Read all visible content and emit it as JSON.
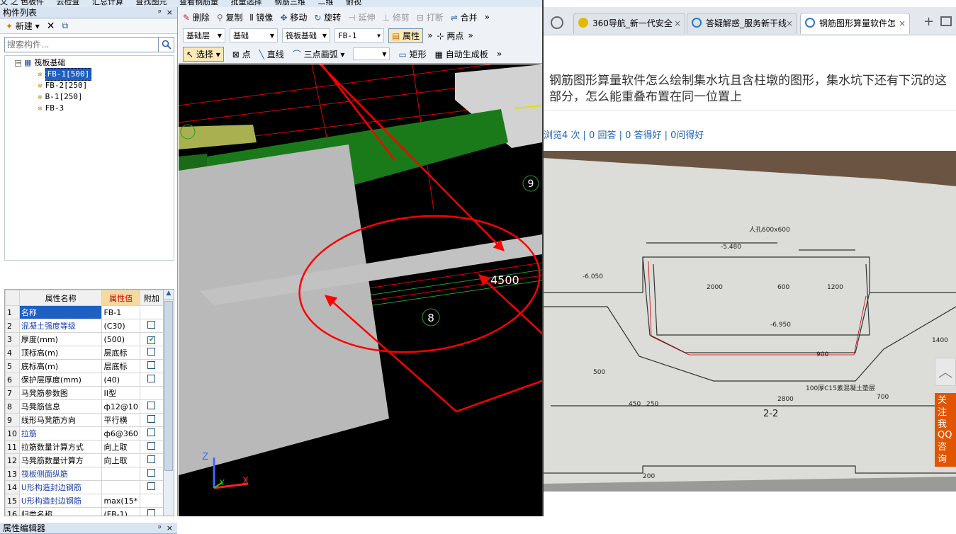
{
  "top_strip": {
    "items": [
      "文 之 色板件",
      "云检查",
      "汇总计算",
      "查找图元",
      "查看钢筋量",
      "批量选择",
      "钢筋三维",
      "二维",
      "俯视"
    ]
  },
  "left_panel": {
    "title": "构件列表",
    "controls": [
      "ᵖ",
      "×"
    ],
    "toolbar": {
      "new_label": "新建 ▾",
      "delete_icon": "✕",
      "copy_icon": "⧉"
    },
    "search": {
      "placeholder": "搜索构件..."
    },
    "tree": {
      "root": "筏板基础",
      "children": [
        "FB-1[500]",
        "FB-2[250]",
        "B-1[250]",
        "FB-3"
      ]
    }
  },
  "prop_editor": {
    "title": "属性编辑器",
    "controls": [
      "ᵖ",
      "×"
    ],
    "headers": [
      "属性名称",
      "属性值",
      "附加"
    ],
    "rows": [
      {
        "no": "1",
        "name": "名称",
        "value": "FB-1",
        "check": "none",
        "blue": true
      },
      {
        "no": "2",
        "name": "混凝土强度等级",
        "value": "(C30)",
        "check": "unchecked",
        "blue": true
      },
      {
        "no": "3",
        "name": "厚度(mm)",
        "value": "(500)",
        "check": "checked",
        "blue": false
      },
      {
        "no": "4",
        "name": "顶标高(m)",
        "value": "层底标",
        "check": "unchecked",
        "blue": false
      },
      {
        "no": "5",
        "name": "底标高(m)",
        "value": "层底标",
        "check": "unchecked",
        "blue": false
      },
      {
        "no": "6",
        "name": "保护层厚度(mm)",
        "value": "(40)",
        "check": "unchecked",
        "blue": false
      },
      {
        "no": "7",
        "name": "马凳筋参数图",
        "value": "II型",
        "check": "none",
        "blue": false
      },
      {
        "no": "8",
        "name": "马凳筋信息",
        "value": "ф12@10",
        "check": "unchecked",
        "blue": false
      },
      {
        "no": "9",
        "name": "线形马凳筋方向",
        "value": "平行横",
        "check": "unchecked",
        "blue": false
      },
      {
        "no": "10",
        "name": "拉筋",
        "value": "ф6@360",
        "check": "unchecked",
        "blue": true
      },
      {
        "no": "11",
        "name": "拉筋数量计算方式",
        "value": "向上取",
        "check": "unchecked",
        "blue": false
      },
      {
        "no": "12",
        "name": "马凳筋数量计算方",
        "value": "向上取",
        "check": "unchecked",
        "blue": false
      },
      {
        "no": "13",
        "name": "筏板侧面纵筋",
        "value": "",
        "check": "unchecked",
        "blue": true
      },
      {
        "no": "14",
        "name": "U形构造封边钢筋",
        "value": "",
        "check": "unchecked",
        "blue": true
      },
      {
        "no": "15",
        "name": "U形构造封边钢筋",
        "value": "max(15*",
        "check": "none",
        "blue": true
      },
      {
        "no": "16",
        "name": "归类名称",
        "value": "(FB-1)",
        "check": "unchecked",
        "blue": false
      }
    ]
  },
  "toolbar": {
    "row1": {
      "delete": "删除",
      "copy": "复制",
      "mirror": "镜像",
      "move": "移动",
      "rotate": "旋转",
      "extend": "延伸",
      "trim": "修剪",
      "break": "打断",
      "merge": "合并",
      "more": "»"
    },
    "row2": {
      "floor": "基础层",
      "type": "基础",
      "category": "筏板基础",
      "component": "FB-1",
      "properties": "属性",
      "two_points": "两点",
      "more": "»"
    },
    "row3": {
      "select": "选择",
      "point": "点",
      "line": "直线",
      "arc": "三点画弧",
      "rect": "矩形",
      "auto": "自动生成板",
      "more": "»"
    }
  },
  "viewport": {
    "labels": {
      "dim": "4500",
      "axis8": "8",
      "axis9": "9",
      "axis_z": "Z",
      "axis_x": "X",
      "axis_y": "Y"
    },
    "colors": {
      "annotation": "#ff0000",
      "slab": "#b4b4b4",
      "beam_green": "#1a7a1a",
      "beam_olive": "#a8b050"
    }
  },
  "browser": {
    "tabs": [
      {
        "label": "360导航_新一代安全",
        "close": "×"
      },
      {
        "label": "答疑解惑_服务新干线",
        "close": "×"
      },
      {
        "label": "钢筋图形算量软件怎",
        "close": "×"
      }
    ],
    "new_tab": "+",
    "question_title": "钢筋图形算量软件怎么绘制集水坑且含柱墩的图形，集水坑下还有下沉的这部分，怎么能重叠布置在同一位置上",
    "stats": "浏览4 次 | 0 回答 | 0 答得好 | 0问得好",
    "side_buttons": [
      "关注我们",
      "QQ咨询"
    ],
    "drawing": {
      "texts": [
        "人孔600x600",
        "-5.480",
        "-6.050",
        "-6.950",
        "2000",
        "600",
        "1200",
        "2800",
        "900",
        "500",
        "450",
        "250",
        "700",
        "1400",
        "100厚C15素混凝土垫层",
        "2-2",
        "200"
      ]
    }
  }
}
